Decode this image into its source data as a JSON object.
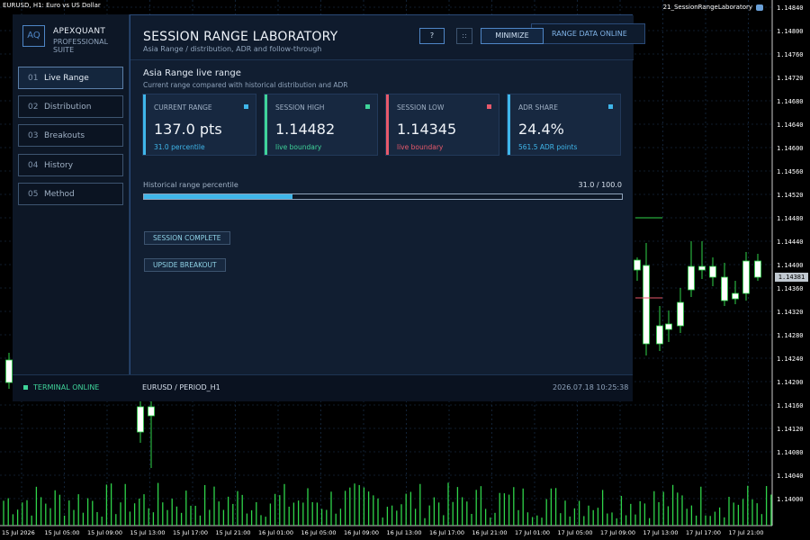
{
  "chart": {
    "title": "EURUSD, H1: Euro vs US Dollar",
    "ea_name": "21_SessionRangeLaboratory",
    "price_badge": "1.14381",
    "price_axis": [
      "1.14840",
      "1.14800",
      "1.14760",
      "1.14720",
      "1.14680",
      "1.14640",
      "1.14600",
      "1.14560",
      "1.14520",
      "1.14480",
      "1.14440",
      "1.14400",
      "1.14360",
      "1.14320",
      "1.14280",
      "1.14240",
      "1.14200",
      "1.14160",
      "1.14120",
      "1.14080",
      "1.14040",
      "1.14000"
    ],
    "time_axis": [
      "15 Jul 2026",
      "15 Jul 05:00",
      "15 Jul 09:00",
      "15 Jul 13:00",
      "15 Jul 17:00",
      "15 Jul 21:00",
      "16 Jul 01:00",
      "16 Jul 05:00",
      "16 Jul 09:00",
      "16 Jul 13:00",
      "16 Jul 17:00",
      "16 Jul 21:00",
      "17 Jul 01:00",
      "17 Jul 05:00",
      "17 Jul 09:00",
      "17 Jul 13:00",
      "17 Jul 17:00",
      "17 Jul 21:00"
    ],
    "colors": {
      "up": "#ffffff",
      "down": "#000000",
      "wick": "#2fd44a",
      "grid": "#1f3a5a",
      "volume": "#2fd44a"
    }
  },
  "panel": {
    "brand_name": "APEXQUANT",
    "brand_sub": "PROFESSIONAL SUITE",
    "logo": "AQ",
    "nav": [
      {
        "num": "01",
        "label": "Live Range"
      },
      {
        "num": "02",
        "label": "Distribution"
      },
      {
        "num": "03",
        "label": "Breakouts"
      },
      {
        "num": "04",
        "label": "History"
      },
      {
        "num": "05",
        "label": "Method"
      }
    ],
    "title": "SESSION RANGE LABORATORY",
    "subtitle": "Asia Range / distribution, ADR and follow-through",
    "help_label": "?",
    "drag_label": "::",
    "minimize_label": "MINIMIZE",
    "online_tag": "RANGE DATA ONLINE",
    "section_title": "Asia Range live range",
    "section_sub": "Current range compared with historical distribution and ADR",
    "cards": [
      {
        "label": "CURRENT RANGE",
        "value": "137.0 pts",
        "note": "31.0 percentile",
        "color": "#3fb6ea"
      },
      {
        "label": "SESSION HIGH",
        "value": "1.14482",
        "note": "live boundary",
        "color": "#3fd49a"
      },
      {
        "label": "SESSION LOW",
        "value": "1.14345",
        "note": "live boundary",
        "color": "#e8596b"
      },
      {
        "label": "ADR SHARE",
        "value": "24.4%",
        "note": "561.5 ADR points",
        "color": "#3fb6ea"
      }
    ],
    "percentile_label": "Historical range percentile",
    "percentile_text": "31.0 / 100.0",
    "percentile_value": 0.31,
    "status_chips": [
      "SESSION COMPLETE",
      "UPSIDE BREAKOUT"
    ],
    "footer": {
      "status": "TERMINAL ONLINE",
      "symbol": "EURUSD  /  PERIOD_H1",
      "timestamp": "2026.07.18 10:25:38"
    }
  }
}
